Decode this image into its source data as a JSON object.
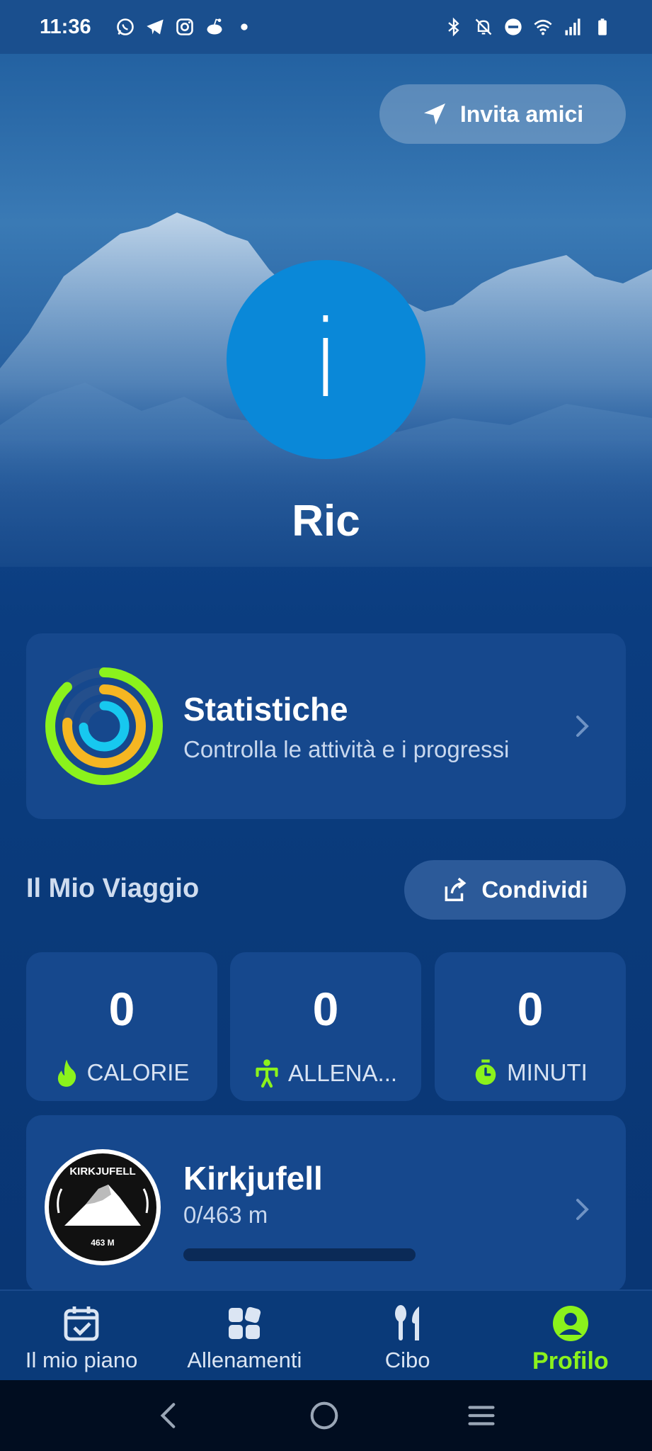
{
  "status_bar": {
    "time": "11:36",
    "left_icons": [
      "whatsapp-icon",
      "telegram-icon",
      "instagram-icon",
      "reddit-icon",
      "dot-icon"
    ],
    "right_icons": [
      "bluetooth-icon",
      "bell-off-icon",
      "dnd-icon",
      "wifi-icon",
      "signal-icon",
      "battery-icon"
    ]
  },
  "header": {
    "invite_label": "Invita amici"
  },
  "profile": {
    "avatar_letter": "i",
    "name": "Ric"
  },
  "stats_card": {
    "title": "Statistiche",
    "subtitle": "Controlla le attività e i progressi"
  },
  "journey": {
    "title": "Il Mio Viaggio",
    "share_label": "Condividi",
    "metrics": [
      {
        "value": "0",
        "label": "CALORIE",
        "icon": "flame-icon"
      },
      {
        "value": "0",
        "label": "ALLENA...",
        "icon": "workout-icon"
      },
      {
        "value": "0",
        "label": "MINUTI",
        "icon": "timer-icon"
      }
    ]
  },
  "mountain_card": {
    "title": "Kirkjufell",
    "progress_text": "0/463 m",
    "progress_fraction": 0,
    "badge_top": "KIRKJUFELL",
    "badge_bottom": "463 M"
  },
  "bottom_nav": {
    "items": [
      {
        "label": "Il mio piano",
        "icon": "calendar-check-icon",
        "active": false
      },
      {
        "label": "Allenamenti",
        "icon": "grid-icon",
        "active": false
      },
      {
        "label": "Cibo",
        "icon": "cutlery-icon",
        "active": false
      },
      {
        "label": "Profilo",
        "icon": "user-circle-icon",
        "active": true
      }
    ]
  },
  "system_nav": [
    "back-icon",
    "home-icon",
    "recents-icon"
  ],
  "colors": {
    "accent": "#8bf21c",
    "background": "#0b3d80",
    "card": "#16488d",
    "avatar": "#0a88d8",
    "ring_outer": "#8bf21c",
    "ring_middle": "#f5b622",
    "ring_inner": "#17c8ef"
  }
}
